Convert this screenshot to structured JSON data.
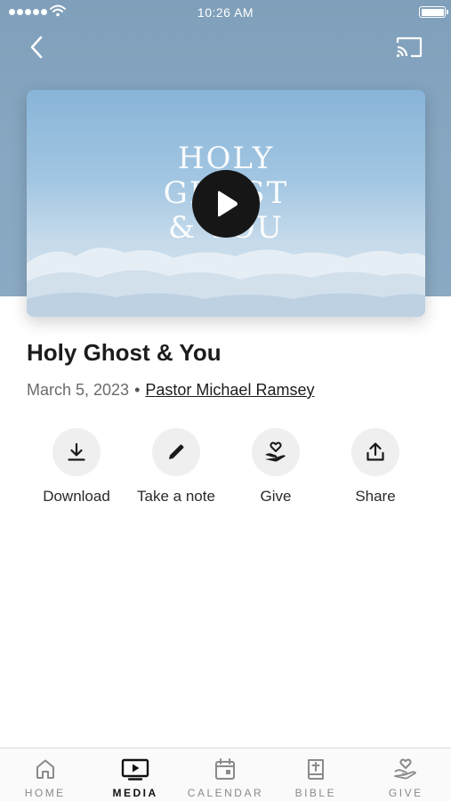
{
  "status_bar": {
    "time": "10:26 AM"
  },
  "nav": {
    "back_icon": "chevron-left-icon",
    "cast_icon": "cast-icon"
  },
  "hero": {
    "thumbnail_text": [
      "HOLY",
      "GHOST",
      "& YOU"
    ],
    "play_icon": "play-icon"
  },
  "sermon": {
    "title": "Holy Ghost & You",
    "date": "March 5, 2023",
    "separator": "•",
    "speaker": "Pastor Michael Ramsey"
  },
  "actions": [
    {
      "label": "Download",
      "icon": "download-icon"
    },
    {
      "label": "Take a note",
      "icon": "pencil-icon"
    },
    {
      "label": "Give",
      "icon": "heart-hand-icon"
    },
    {
      "label": "Share",
      "icon": "share-icon"
    }
  ],
  "tabs": [
    {
      "label": "HOME",
      "icon": "home-icon",
      "active": false
    },
    {
      "label": "MEDIA",
      "icon": "tv-play-icon",
      "active": true
    },
    {
      "label": "CALENDAR",
      "icon": "calendar-icon",
      "active": false
    },
    {
      "label": "BIBLE",
      "icon": "bible-icon",
      "active": false
    },
    {
      "label": "GIVE",
      "icon": "heart-hand-icon",
      "active": false
    }
  ],
  "colors": {
    "hero_background": "#87a7c2",
    "text_primary": "#1c1c1c",
    "text_secondary": "#6b6b6b",
    "action_circle": "#efefef"
  }
}
